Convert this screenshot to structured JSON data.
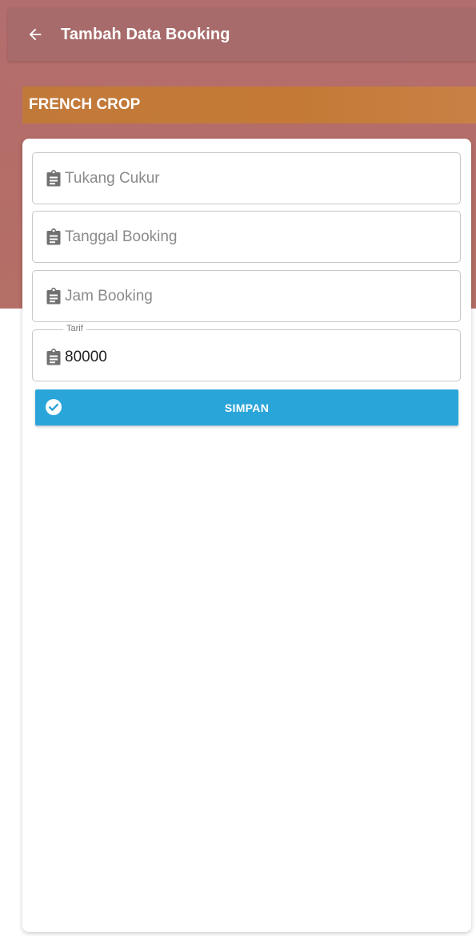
{
  "appbar": {
    "title": "Tambah Data Booking",
    "back_icon": "arrow-left-icon"
  },
  "banner": {
    "title": "FRENCH CROP"
  },
  "form": {
    "barber": {
      "placeholder": "Tukang Cukur",
      "value": "",
      "icon": "clipboard-icon"
    },
    "date": {
      "placeholder": "Tanggal Booking",
      "value": "",
      "icon": "clipboard-icon"
    },
    "time": {
      "placeholder": "Jam Booking",
      "value": "",
      "icon": "clipboard-icon"
    },
    "price": {
      "label": "Tarif",
      "value": "80000",
      "icon": "clipboard-icon"
    }
  },
  "save_button": {
    "label": "SIMPAN",
    "icon": "check-circle-icon"
  },
  "colors": {
    "appbar": "#a86b6b",
    "banner": "#c47a36",
    "button": "#2aa5da"
  }
}
